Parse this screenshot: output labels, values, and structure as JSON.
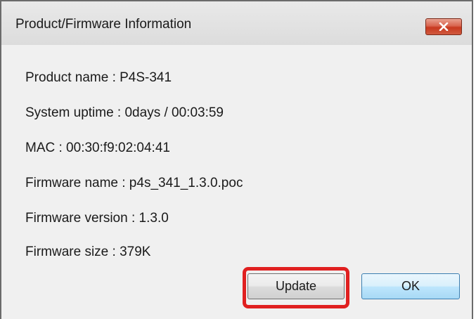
{
  "window": {
    "title": "Product/Firmware Information",
    "close_icon": "close-icon"
  },
  "info": {
    "product_name": "Product name : P4S-341",
    "system_uptime": "System uptime : 0days / 00:03:59",
    "mac": "MAC : 00:30:f9:02:04:41",
    "firmware_name": "Firmware name : p4s_341_1.3.0.poc",
    "firmware_version": "Firmware version : 1.3.0",
    "firmware_size": "Firmware size : 379K"
  },
  "buttons": {
    "update_label": "Update",
    "ok_label": "OK"
  },
  "colors": {
    "highlight": "#e02020",
    "close_button": "#c8391f"
  }
}
